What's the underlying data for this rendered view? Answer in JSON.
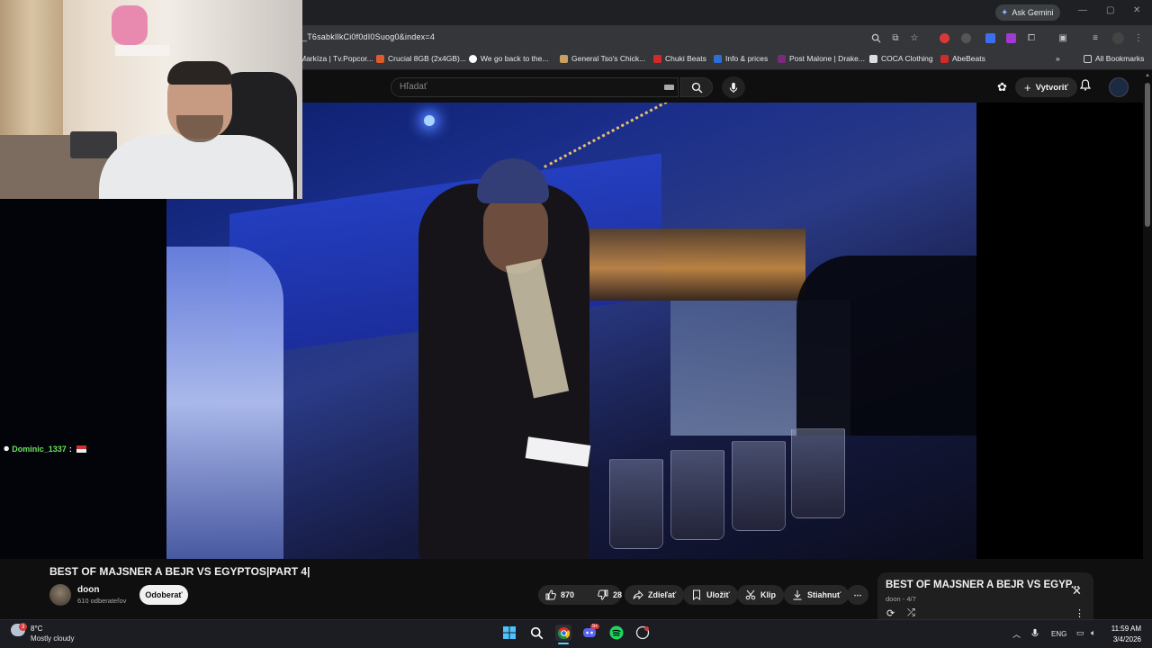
{
  "browser": {
    "ask_gemini": "Ask Gemini",
    "url": "_T6sabkIlkCi0f0dI0Suog0&index=4",
    "bookmarks": [
      {
        "label": "Markíza | Tv.Popcor...",
        "color": "#e0a030"
      },
      {
        "label": "Crucial 8GB (2x4GB)...",
        "color": "#e05a2b"
      },
      {
        "label": "We go back to the...",
        "color": "#ffffff"
      },
      {
        "label": "General Tso's Chick...",
        "color": "#c8a060"
      },
      {
        "label": "Chuki Beats",
        "color": "#d02a2a"
      },
      {
        "label": "Info & prices",
        "color": "#2b6fd6"
      },
      {
        "label": "Post Malone | Drake...",
        "color": "#7a2a7a"
      },
      {
        "label": "COCA Clothing",
        "color": "#dddddd"
      },
      {
        "label": "AbeBeats",
        "color": "#d02a2a"
      }
    ],
    "overflow": "»",
    "all_bookmarks": "All Bookmarks"
  },
  "youtube_header": {
    "search_placeholder": "Hľadať",
    "create_label": "Vytvoriť"
  },
  "chat": {
    "username": "Dominic_1337",
    "colon": ":"
  },
  "video": {
    "title": "BEST OF MAJSNER A BEJR VS EGYPTOS|PART 4|",
    "channel": "doon",
    "subscribers": "610 odberateľov",
    "subscribe_label": "Odoberať",
    "likes": "870",
    "dislikes": "28",
    "share_label": "Zdieľať",
    "save_label": "Uložiť",
    "clip_label": "Klip",
    "download_label": "Stiahnuť"
  },
  "playlist": {
    "title": "BEST OF MAJSNER A BEJR VS EGYP...",
    "subtitle": "doon - 4/7"
  },
  "taskbar": {
    "temperature": "8°C",
    "weather": "Mostly cloudy",
    "weather_badge": "3",
    "discord_badge": "9+",
    "language": "ENG",
    "time": "11:59 AM",
    "date": "3/4/2026"
  }
}
